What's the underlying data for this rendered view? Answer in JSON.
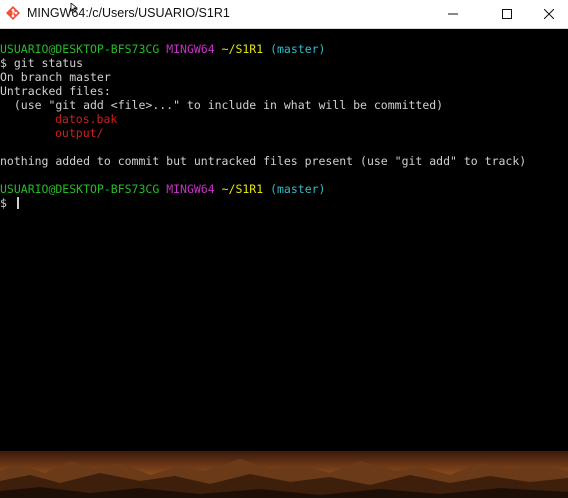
{
  "window": {
    "title": "MINGW64:/c/Users/USUARIO/S1R1",
    "app_icon": "git-bash-icon",
    "controls": [
      "minimize-icon",
      "maximize-icon",
      "close-icon"
    ]
  },
  "terminal": {
    "prompt1": {
      "user_host": "USUARIO@DESKTOP-BFS73CG",
      "shell": "MINGW64",
      "path": "~/S1R1",
      "branch": "(master)"
    },
    "command_line": "$ git status",
    "output": {
      "branch_line": "On branch master",
      "untracked_header": "Untracked files:",
      "hint": "  (use \"git add <file>...\" to include in what will be committed)",
      "files": [
        "datos.bak",
        "output/"
      ],
      "summary": "nothing added to commit but untracked files present (use \"git add\" to track)"
    },
    "prompt2": {
      "user_host": "USUARIO@DESKTOP-BFS73CG",
      "shell": "MINGW64",
      "path": "~/S1R1",
      "branch": "(master)"
    },
    "input_line": "$ "
  },
  "colors": {
    "background": "#000000",
    "text": "#d0d0d0",
    "user_host": "#25bc24",
    "shell": "#c930c7",
    "path": "#e5e512",
    "branch": "#33bbc8",
    "untracked": "#cc2020"
  }
}
